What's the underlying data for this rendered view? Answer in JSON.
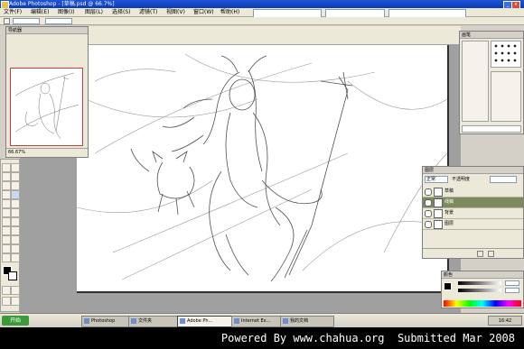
{
  "title_bar": {
    "text": "Adobe Photoshop - [草稿.psd @ 66.7%]"
  },
  "menu": {
    "items": [
      "文件(F)",
      "编辑(E)",
      "图像(I)",
      "图层(L)",
      "选择(S)",
      "滤镜(T)",
      "视图(V)",
      "窗口(W)",
      "帮助(H)"
    ]
  },
  "navigator": {
    "title": "导航器",
    "zoom": "66.67%"
  },
  "brushes": {
    "title": "画笔"
  },
  "layers": {
    "title": "图层",
    "mode": "正常",
    "opacity": "不透明度",
    "items": [
      {
        "name": "草稿"
      },
      {
        "name": "线稿"
      },
      {
        "name": "背景"
      },
      {
        "name": "图层"
      }
    ]
  },
  "color": {
    "title": "颜色"
  },
  "taskbar": {
    "start": "开始",
    "tasks": [
      "Photoshop",
      "文件夹",
      "Adobe Ph...",
      "Internet Ex...",
      "我的文档"
    ],
    "clock": "16:42"
  },
  "footer": {
    "text": "Powered By www.chahua.org  Submitted Mar 2008"
  },
  "colors": {
    "titlebar": "#1f54d6",
    "workspace": "#a0a0a0",
    "footer_bg": "#000000"
  }
}
